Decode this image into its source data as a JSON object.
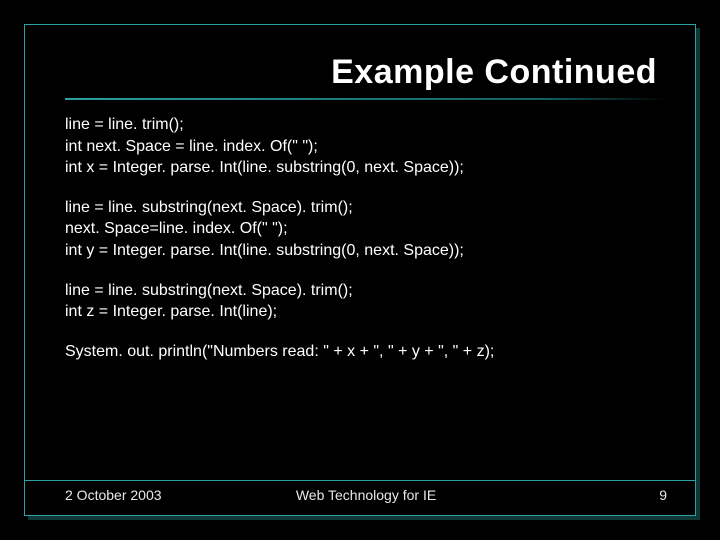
{
  "title": "Example Continued",
  "code": {
    "block1": "line = line. trim();\nint next. Space = line. index. Of(\" \");\nint x = Integer. parse. Int(line. substring(0, next. Space));",
    "block2": "line = line. substring(next. Space). trim();\nnext. Space=line. index. Of(\" \");\nint y = Integer. parse. Int(line. substring(0, next. Space));",
    "block3": "line = line. substring(next. Space). trim();\nint z = Integer. parse. Int(line);",
    "block4": "System. out. println(\"Numbers read: \" + x + \", \" + y + \", \" + z);"
  },
  "footer": {
    "date": "2 October 2003",
    "course": "Web Technology for IE",
    "page": "9"
  }
}
